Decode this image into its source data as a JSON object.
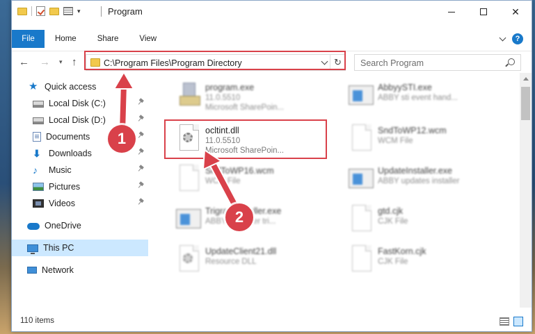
{
  "window": {
    "title": "Program",
    "controls": {
      "minimize_icon": "minimize-icon",
      "maximize_icon": "maximize-icon",
      "close_glyph": "✕"
    }
  },
  "ribbon": {
    "tabs": [
      {
        "label": "File",
        "active": true
      },
      {
        "label": "Home"
      },
      {
        "label": "Share"
      },
      {
        "label": "View"
      }
    ],
    "help_glyph": "?"
  },
  "address_bar": {
    "path": "C:\\Program Files\\Program Directory",
    "refresh_glyph": "↻"
  },
  "search": {
    "placeholder": "Search Program"
  },
  "navigation": {
    "back_glyph": "←",
    "forward_glyph": "→",
    "recent_glyph": "▾",
    "up_glyph": "↑"
  },
  "sidebar": {
    "items": [
      {
        "label": "Quick access",
        "icon": "star-icon",
        "pinned": false
      },
      {
        "label": "Local Disk (C:)",
        "icon": "disk-icon",
        "pinned": true
      },
      {
        "label": "Local Disk (D:)",
        "icon": "disk-icon",
        "pinned": true
      },
      {
        "label": "Documents",
        "icon": "documents-icon",
        "pinned": true
      },
      {
        "label": "Downloads",
        "icon": "download-icon",
        "pinned": true
      },
      {
        "label": "Music",
        "icon": "music-icon",
        "pinned": true
      },
      {
        "label": "Pictures",
        "icon": "pictures-icon",
        "pinned": true
      },
      {
        "label": "Videos",
        "icon": "videos-icon",
        "pinned": true
      },
      {
        "label": "OneDrive",
        "icon": "cloud-icon",
        "pinned": false
      },
      {
        "label": "This PC",
        "icon": "computer-icon",
        "pinned": false,
        "selected": true
      },
      {
        "label": "Network",
        "icon": "network-icon",
        "pinned": false
      }
    ]
  },
  "files": [
    {
      "name": "program.exe",
      "line1": "11.0.5510",
      "line2": "Microsoft SharePoin...",
      "icon": "program-icon"
    },
    {
      "name": "AbbyySTI.exe",
      "line1": "ABBY sti event hand...",
      "line2": "",
      "icon": "app-window-icon"
    },
    {
      "name": "ocltint.dll",
      "line1": "11.0.5510",
      "line2": "Microsoft SharePoin...",
      "icon": "dll-gear-icon",
      "highlighted": true
    },
    {
      "name": "SndToWP12.wcm",
      "line1": "WCM File",
      "line2": "",
      "icon": "blank-file-icon"
    },
    {
      "name": "SndToWP16.wcm",
      "line1": "WCM File",
      "line2": "",
      "icon": "blank-file-icon"
    },
    {
      "name": "UpdateInstaller.exe",
      "line1": "ABBY updates installer",
      "line2": "",
      "icon": "app-window-icon"
    },
    {
      "name": "TrigramInstaller.exe",
      "line1": "ABBYY Reader tri...",
      "line2": "",
      "icon": "app-window-icon"
    },
    {
      "name": "gtd.cjk",
      "line1": "CJK File",
      "line2": "",
      "icon": "blank-file-icon"
    },
    {
      "name": "UpdateClient21.dll",
      "line1": "Resource DLL",
      "line2": "",
      "icon": "dll-gear-icon"
    },
    {
      "name": "FastKorn.cjk",
      "line1": "CJK File",
      "line2": "",
      "icon": "blank-file-icon"
    }
  ],
  "status_bar": {
    "item_count": "110 items"
  },
  "annotations": {
    "step_1": "1",
    "step_2": "2",
    "highlight_color": "#d9414a"
  },
  "colors": {
    "accent": "#1979ca",
    "selection": "#cce8ff"
  }
}
